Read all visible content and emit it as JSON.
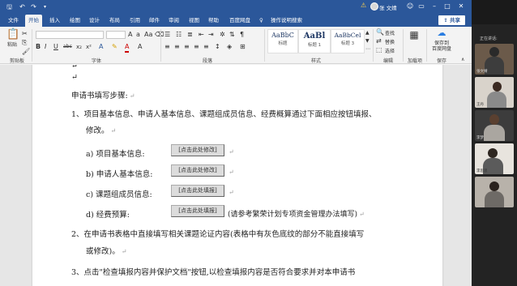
{
  "titlebar": {
    "doc_title": "张 文婧",
    "icons": [
      "save-icon",
      "undo-icon",
      "redo-icon",
      "customize-icon"
    ]
  },
  "tabs": [
    "文件",
    "开始",
    "插入",
    "绘图",
    "设计",
    "布局",
    "引用",
    "邮件",
    "审阅",
    "视图",
    "帮助",
    "百度网盘",
    "操作说明搜索"
  ],
  "active_tab": "开始",
  "share_label": "共享",
  "ribbon": {
    "paste_label": "粘贴",
    "groups": {
      "clipboard": "剪贴板",
      "font": "字体",
      "paragraph": "段落",
      "styles": "样式",
      "editing": "编辑",
      "addins": "加载项",
      "save": "保存"
    },
    "styles": [
      {
        "sample": "AaBbC",
        "name": "标题"
      },
      {
        "sample": "AaBl",
        "name": "标题 1"
      },
      {
        "sample": "AaBbCel",
        "name": "标题 3"
      }
    ],
    "editing": {
      "find": "查找",
      "replace": "替换",
      "select": "选择"
    },
    "baidu_save": "保存到\n百度网盘",
    "font_tools": [
      "B",
      "I",
      "U",
      "abc",
      "x₂",
      "x²",
      "A"
    ]
  },
  "document": {
    "heading": "申请书填写步骤:",
    "item1": "1、项目基本信息、申请人基本信息、课题组成员信息、经费概算通过下面相应按钮填报、",
    "item1_cont": "修改。",
    "sub_a": "a)   项目基本信息:",
    "sub_b": "b)   申请人基本信息:",
    "sub_c": "c)   课题组成员信息:",
    "sub_d": "d)   经费预算:",
    "btn_a": "[点击此处修改]",
    "btn_b": "[点击此处修改]",
    "btn_c": "[点击此处填报]",
    "btn_d": "[点击此处填报]",
    "note_d": "(请参考繁荣计划专项资金管理办法填写)",
    "item2": "2、在申请书表格中直接填写相关课题论证内容(表格中有灰色底纹的部分不能直接填写",
    "item2_cont": "或修改)。",
    "item3": "3、点击\"检查填报内容并保护文档\"按钮,以检查填报内容是否符合要求并对本申请书",
    "para_mark": "↵"
  },
  "meeting": {
    "label": "正在讲话:",
    "participants": [
      "张文婧",
      "王丹",
      "李梦",
      "李思思"
    ]
  },
  "colors": {
    "word_blue": "#2b579a",
    "ribbon_bg": "#f3f3f3",
    "meeting_bg": "#232323"
  }
}
